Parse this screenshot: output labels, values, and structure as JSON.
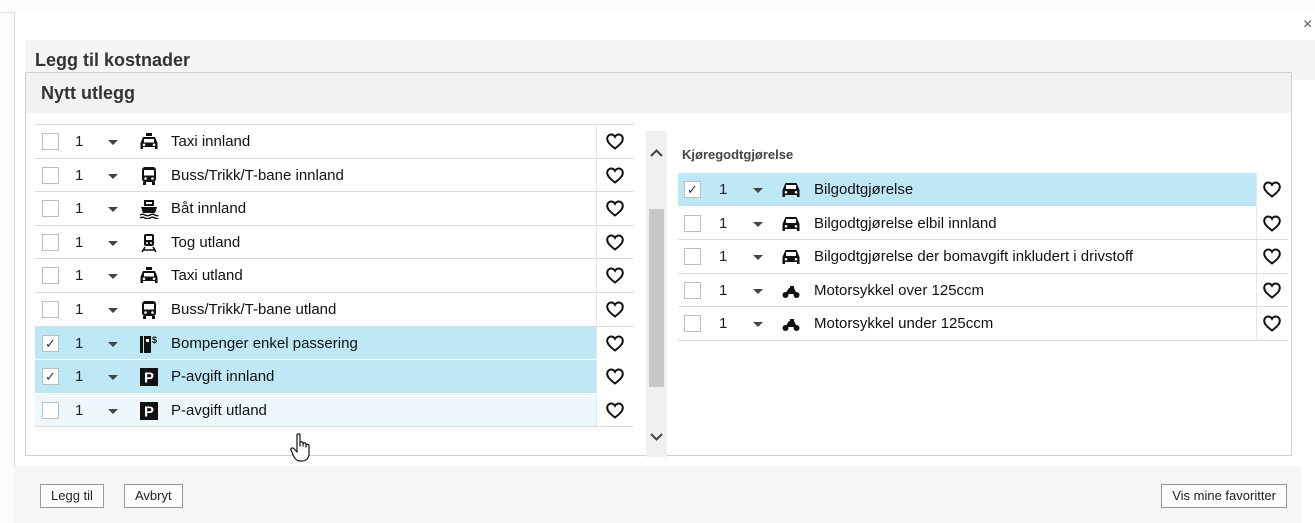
{
  "dialog": {
    "title": "Legg til kostnader",
    "close_glyph": "×"
  },
  "panel": {
    "title": "Nytt utlegg"
  },
  "left_list": {
    "items": [
      {
        "qty": "1",
        "label": "Taxi innland",
        "icon": "taxi-icon",
        "checked": false
      },
      {
        "qty": "1",
        "label": "Buss/Trikk/T-bane innland",
        "icon": "bus-icon",
        "checked": false
      },
      {
        "qty": "1",
        "label": "Båt innland",
        "icon": "boat-icon",
        "checked": false
      },
      {
        "qty": "1",
        "label": "Tog utland",
        "icon": "train-icon",
        "checked": false
      },
      {
        "qty": "1",
        "label": "Taxi utland",
        "icon": "taxi-icon",
        "checked": false
      },
      {
        "qty": "1",
        "label": "Buss/Trikk/T-bane utland",
        "icon": "bus-icon",
        "checked": false
      },
      {
        "qty": "1",
        "label": "Bompenger enkel passering",
        "icon": "toll-icon",
        "checked": true
      },
      {
        "qty": "1",
        "label": "P-avgift innland",
        "icon": "parking-icon",
        "checked": true
      },
      {
        "qty": "1",
        "label": "P-avgift utland",
        "icon": "parking-icon",
        "checked": false
      }
    ]
  },
  "right_section": {
    "title": "Kjøregodtgjørelse",
    "items": [
      {
        "qty": "1",
        "label": "Bilgodtgjørelse",
        "icon": "car-icon",
        "checked": true
      },
      {
        "qty": "1",
        "label": "Bilgodtgjørelse elbil innland",
        "icon": "car-icon",
        "checked": false
      },
      {
        "qty": "1",
        "label": "Bilgodtgjørelse der bomavgift inkludert i drivstoff",
        "icon": "car-icon",
        "checked": false
      },
      {
        "qty": "1",
        "label": "Motorsykkel over 125ccm",
        "icon": "motorcycle-icon",
        "checked": false
      },
      {
        "qty": "1",
        "label": "Motorsykkel under 125ccm",
        "icon": "motorcycle-icon",
        "checked": false
      }
    ]
  },
  "footer": {
    "add_label": "Legg til",
    "cancel_label": "Avbryt",
    "favorites_label": "Vis mine favoritter"
  },
  "check_glyph": "✓",
  "colors": {
    "selected_row": "#bfe8f7",
    "hover_row": "#eef8fc",
    "border": "#dcdcdc"
  }
}
